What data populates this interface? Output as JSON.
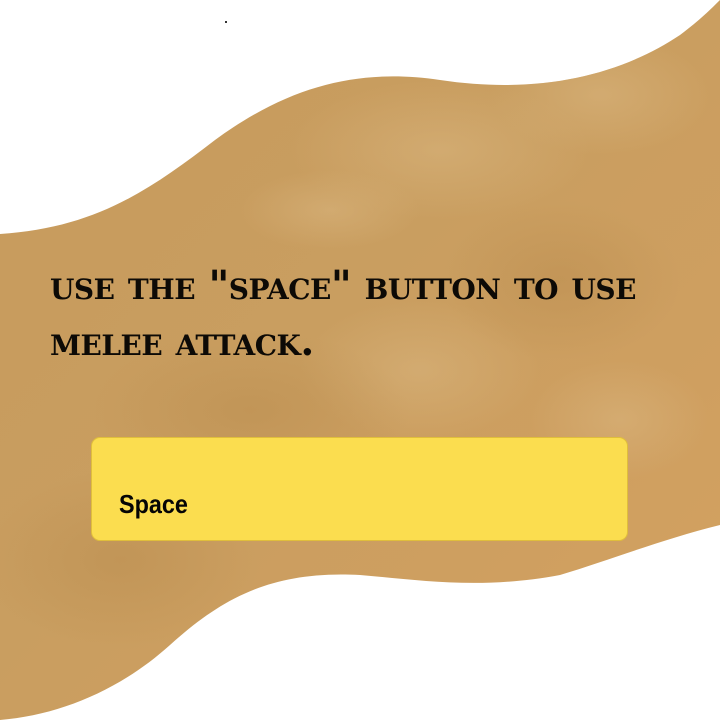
{
  "tutorial": {
    "instruction": "use the \"space\" button to use melee attack."
  },
  "key_prompt": {
    "label": "Space"
  },
  "colors": {
    "parchment": "#c99d5e",
    "panel": "#fbdd4f",
    "text": "#0d0a06"
  }
}
